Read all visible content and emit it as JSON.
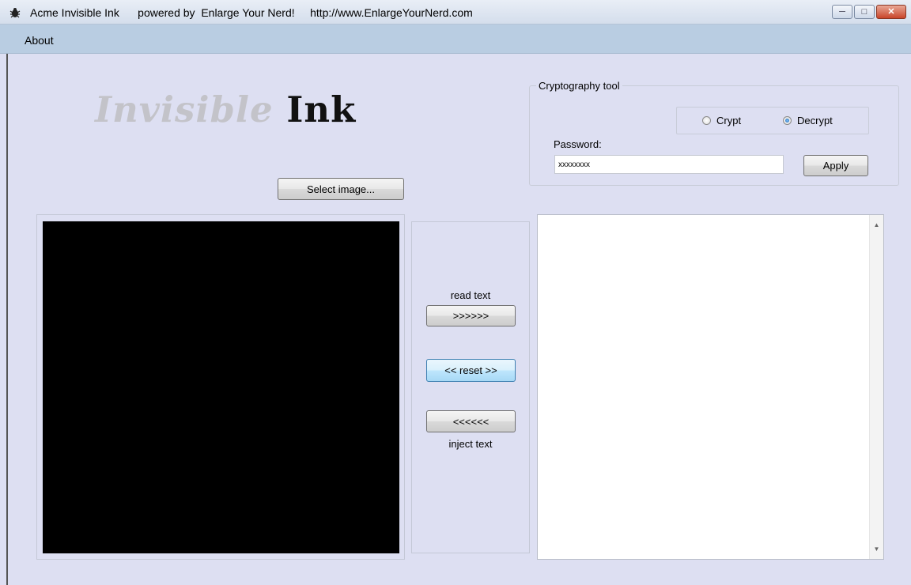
{
  "window": {
    "title": "Acme Invisible Ink      powered by  Enlarge Your Nerd!     http://www.EnlargeYourNerd.com",
    "icon": "bug-icon",
    "controls": [
      "minimize-icon",
      "maximize-icon",
      "close-icon"
    ]
  },
  "menu": {
    "about": "About"
  },
  "logo": {
    "faded_part": "Invi",
    "rest": "sible",
    "dark_part": "Ink"
  },
  "select_image_label": "Select image...",
  "crypto": {
    "legend": "Cryptography tool",
    "radio_crypt": "Crypt",
    "radio_decrypt": "Decrypt",
    "selected": "Decrypt",
    "password_label": "Password:",
    "password_value": "xxxxxxxx",
    "apply_label": "Apply"
  },
  "middle": {
    "read_label": "read text",
    "read_button": ">>>>>>",
    "reset_button": "<< reset >>",
    "inject_button": "<<<<<<",
    "inject_label": "inject text"
  },
  "text_area": {
    "value": ""
  },
  "colors": {
    "background": "#dddff2",
    "menubar": "#b9cde2",
    "image": "#000000"
  }
}
